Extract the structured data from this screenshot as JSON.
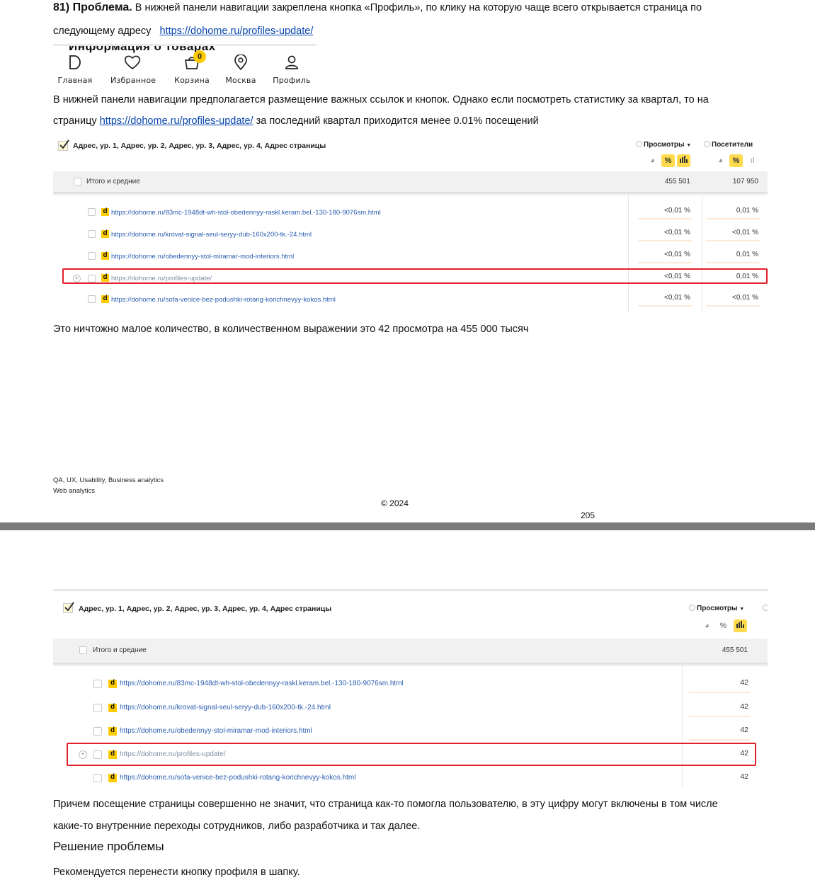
{
  "page1": {
    "heading_bold": "81) Проблема.",
    "intro_line1": " В нижней панели навигации закреплена кнопка «Профиль», по клику на которую чаще всего открывается страница по",
    "intro_line2": "следующему адресу",
    "intro_link": "https://dohome.ru/profiles-update/",
    "navbar": {
      "cut_text": "Информация о товарах",
      "items": [
        {
          "label": "Главная",
          "icon": "home-d-icon"
        },
        {
          "label": "Избранное",
          "icon": "heart-icon"
        },
        {
          "label": "Корзина",
          "icon": "basket-icon",
          "badge": "0"
        },
        {
          "label": "Москва",
          "icon": "location-pin-icon"
        },
        {
          "label": "Профиль",
          "icon": "user-icon"
        }
      ]
    },
    "p2_line1": "В нижней панели навигации предполагается размещение важных ссылок и кнопок. Однако если посмотреть статистику за квартал, то на",
    "p2_line2_pre": "страницу ",
    "p2_link": "https://dohome.ru/profiles-update/",
    "p2_line2_post": " за последний квартал приходится менее 0.01% посещений",
    "table1": {
      "header": "Адрес, ур. 1, Адрес, ур. 2, Адрес, ур. 3, Адрес, ур. 4, Адрес страницы",
      "col_views": "Просмотры",
      "col_views_sort": "▼",
      "col_visitors": "Посетители",
      "total_label": "Итого и средние",
      "total_views": "455 501",
      "total_visitors": "107 950",
      "rows": [
        {
          "url": "https://dohome.ru/83mc-1948dt-wh-stol-obedennyy-raskl.keram.bel.-130-180-9076sm.html",
          "views": "<0,01 %",
          "visitors": "0,01 %"
        },
        {
          "url": "https://dohome.ru/krovat-signal-seul-seryy-dub-160x200-tk.-24.html",
          "views": "<0,01 %",
          "visitors": "<0,01 %"
        },
        {
          "url": "https://dohome.ru/obedennyy-stol-miramar-mod-interiors.html",
          "views": "<0,01 %",
          "visitors": "0,01 %"
        },
        {
          "url": "https://dohome.ru/profiles-update/",
          "views": "<0,01 %",
          "visitors": "0,01 %"
        },
        {
          "url": "https://dohome.ru/sofa-venice-bez-podushki-rotang-korichnevyy-kokos.html",
          "views": "<0,01 %",
          "visitors": "<0,01 %"
        }
      ]
    },
    "p3": "Это ничтожно малое количество, в количественном выражении это 42 просмотра на 455 000 тысяч",
    "footer_line1": "QA, UX, Usability, Business analytics",
    "footer_line2": "Web analytics",
    "copyright": "© 2024",
    "page_number": "205"
  },
  "page2": {
    "table2": {
      "header": "Адрес, ур. 1, Адрес, ур. 2, Адрес, ур. 3, Адрес, ур. 4, Адрес страницы",
      "col_views": "Просмотры",
      "col_views_sort": "▼",
      "total_label": "Итого и средние",
      "total_views": "455 501",
      "rows": [
        {
          "url": "https://dohome.ru/83mc-1948dt-wh-stol-obedennyy-raskl.keram.bel.-130-180-9076sm.html",
          "views": "42"
        },
        {
          "url": "https://dohome.ru/krovat-signal-seul-seryy-dub-160x200-tk.-24.html",
          "views": "42"
        },
        {
          "url": "https://dohome.ru/obedennyy-stol-miramar-mod-interiors.html",
          "views": "42"
        },
        {
          "url": "https://dohome.ru/profiles-update/",
          "views": "42"
        },
        {
          "url": "https://dohome.ru/sofa-venice-bez-podushki-rotang-korichnevyy-kokos.html",
          "views": "42"
        }
      ]
    },
    "p4_line1": "Причем посещение страницы совершенно не значит, что страница как-то помогла пользователю, в эту цифру могут включены в том числе",
    "p4_line2": "какие-то внутренние переходы сотрудников, либо разработчика и так далее.",
    "solution_heading": "Решение проблемы",
    "solution_text": "Рекомендуется перенести кнопку профиля в шапку."
  },
  "colors": {
    "highlight_red": "#e3202a",
    "yellow": "#ffcc00",
    "link": "#0645ad",
    "page_separator": "#7a7a7a"
  }
}
